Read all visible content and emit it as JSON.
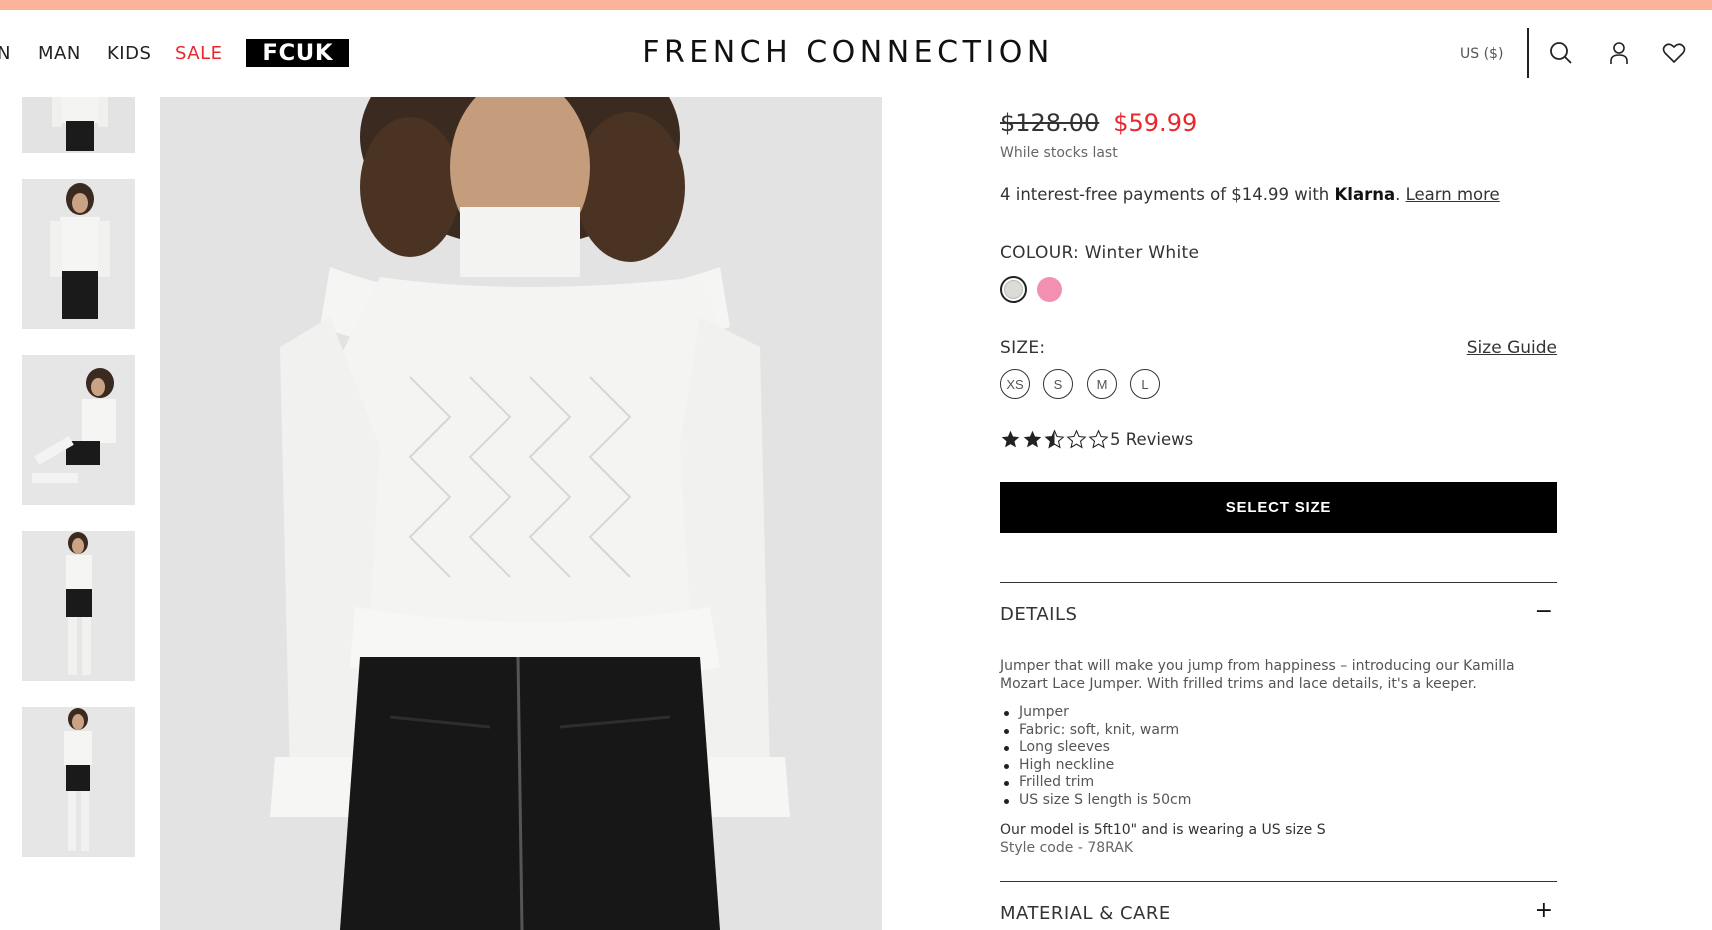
{
  "nav": {
    "items": [
      {
        "label": "N"
      },
      {
        "label": "MAN"
      },
      {
        "label": "KIDS"
      },
      {
        "label": "SALE"
      }
    ],
    "fcuk_logo": "FCUK"
  },
  "brand": "FRENCH CONNECTION",
  "header": {
    "currency": "US ($)",
    "icons": [
      "search-icon",
      "account-icon",
      "wishlist-icon"
    ]
  },
  "product": {
    "price_old": "$128.00",
    "price_new": "$59.99",
    "stock_note": "While stocks last",
    "klarna": {
      "prefix": "4 interest-free payments of $14.99 with ",
      "brand": "Klarna",
      "suffix": ". ",
      "link": "Learn more"
    },
    "colour": {
      "label": "COLOUR: Winter White",
      "swatches": [
        {
          "name": "Winter White",
          "color": "#dcdcd6",
          "selected": true
        },
        {
          "name": "Pink",
          "color": "#f38fb0",
          "selected": false
        }
      ]
    },
    "size": {
      "label": "SIZE:",
      "guide": "Size Guide",
      "options": [
        "XS",
        "S",
        "M",
        "L"
      ]
    },
    "rating": {
      "stars": 2.5,
      "max": 5,
      "reviews_label": "5 Reviews"
    },
    "cta": "SELECT SIZE",
    "details": {
      "title": "DETAILS",
      "toggle": "−",
      "description": "Jumper that will make you jump from happiness – introducing our Kamilla Mozart Lace Jumper. With frilled trims and lace details, it's a keeper.",
      "bullets": [
        "Jumper",
        "Fabric: soft, knit, warm",
        "Long sleeves",
        "High neckline",
        "Frilled trim",
        "US size S length is 50cm"
      ],
      "model_note": "Our model is 5ft10\" and is wearing a US size S",
      "style_code": "Style code - 78RAK"
    },
    "material": {
      "title": "MATERIAL & CARE",
      "toggle": "+"
    }
  },
  "colors": {
    "promo_bar": "#fbb49a",
    "sale_red": "#e8272e",
    "cta_bg": "#000000"
  }
}
